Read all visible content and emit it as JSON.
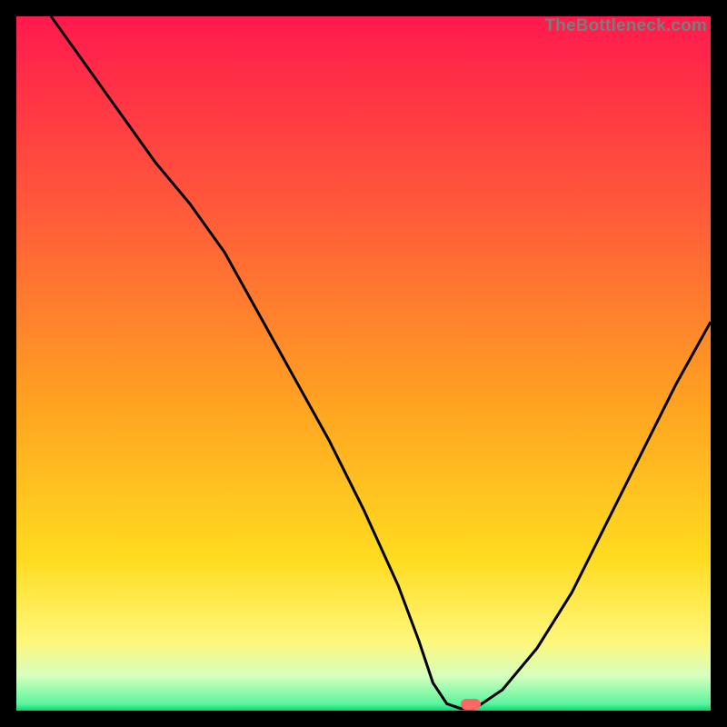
{
  "watermark": "TheBottleneck.com",
  "colors": {
    "frame_bg": "#000000",
    "gradient": {
      "c0": "#ff1a4d",
      "c1": "#ff5a3a",
      "c2": "#ffa321",
      "c3": "#ffdb1f",
      "c4": "#fff77a",
      "c5": "#d6ffbf",
      "c6": "#5cf59e",
      "c7": "#00d978"
    },
    "curve_stroke": "#000000",
    "marker_fill": "#ff6666"
  },
  "marker": {
    "x_pct": 65.5,
    "y_pct": 99.1
  },
  "chart_data": {
    "type": "line",
    "title": "",
    "xlabel": "",
    "ylabel": "",
    "xlim": [
      0,
      100
    ],
    "ylim": [
      0,
      100
    ],
    "note": "y=0 is the green bottom (optimal); y=100 is the red top (worst). Curve dips to minimum around x≈62–66 where the marker sits, then rises again.",
    "series": [
      {
        "name": "bottleneck-curve",
        "x": [
          5,
          10,
          15,
          20,
          25,
          30,
          35,
          40,
          45,
          50,
          55,
          58,
          60,
          62,
          64,
          66,
          70,
          75,
          80,
          85,
          90,
          95,
          100
        ],
        "y": [
          100,
          93,
          86,
          79,
          73,
          66,
          57,
          48,
          39,
          29,
          18,
          10,
          4,
          1,
          0.3,
          0.3,
          3,
          9,
          17,
          27,
          37,
          47,
          56
        ]
      }
    ],
    "marker_point": {
      "x": 65,
      "y": 0.3
    }
  }
}
